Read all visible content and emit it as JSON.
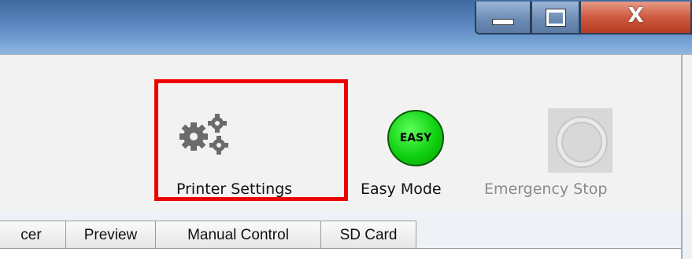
{
  "window_controls": {
    "minimize_icon": "minimize-icon",
    "maximize_icon": "maximize-icon",
    "close_label": "X"
  },
  "toolbar": {
    "printer_settings": {
      "label": "Printer Settings",
      "icon": "gears-icon"
    },
    "easy_mode": {
      "label": "Easy Mode",
      "icon_text": "EASY",
      "color": "#10d010"
    },
    "emergency_stop": {
      "label": "Emergency Stop",
      "icon": "emergency-stop-icon",
      "disabled": true
    }
  },
  "highlight_color": "#ee0000",
  "tabs": [
    {
      "label": "cer"
    },
    {
      "label": "Preview"
    },
    {
      "label": "Manual Control"
    },
    {
      "label": "SD Card"
    }
  ]
}
